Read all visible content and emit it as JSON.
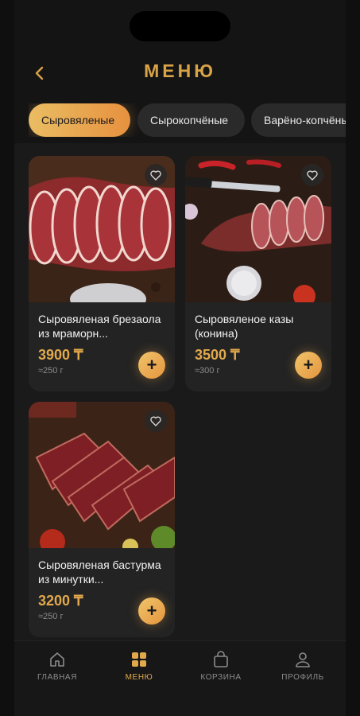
{
  "header": {
    "title": "МЕНЮ",
    "back_icon": "chevron-left-icon"
  },
  "categories": [
    {
      "label": "Сыровяленые",
      "active": true
    },
    {
      "label": "Сырокопчёные",
      "active": false
    },
    {
      "label": "Варёно-копчёные",
      "active": false
    }
  ],
  "products": [
    {
      "name": "Сыровяленая брезаола из мраморн...",
      "price": "3900 ₸",
      "weight": "≈250 г"
    },
    {
      "name": "Сыровяленое казы (конина)",
      "price": "3500 ₸",
      "weight": "≈300 г"
    },
    {
      "name": "Сыровяленая бастурма из минутки...",
      "price": "3200 ₸",
      "weight": "≈250 г"
    }
  ],
  "add_label": "+",
  "tabbar": {
    "home": "ГЛАВНАЯ",
    "menu": "МЕНЮ",
    "cart": "КОРЗИНА",
    "profile": "ПРОФИЛЬ",
    "active": "menu"
  },
  "colors": {
    "accent": "#e2a94c",
    "chip_gradient_start": "#e9bd63",
    "chip_gradient_end": "#e7913f",
    "background": "#141414"
  }
}
